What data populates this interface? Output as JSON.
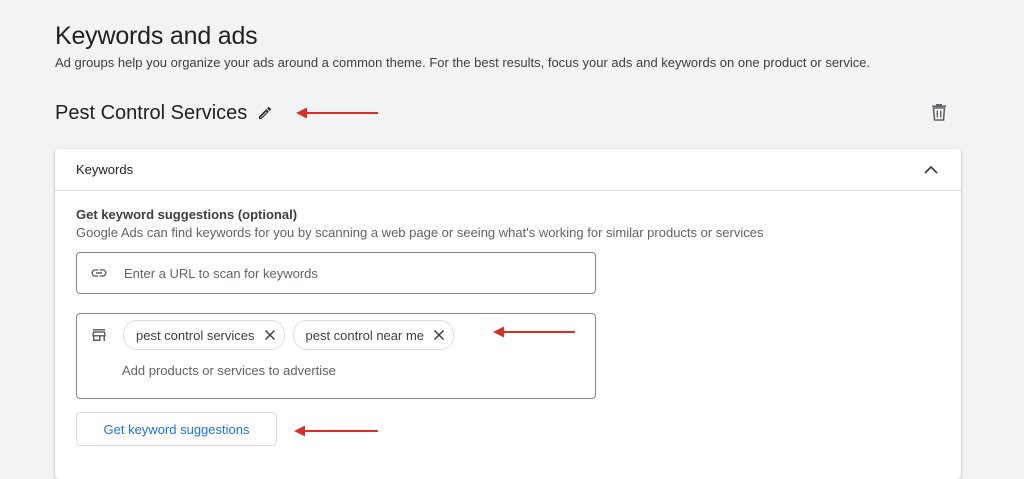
{
  "header": {
    "title": "Keywords and ads",
    "subtitle": "Ad groups help you organize your ads around a common theme. For the best results, focus your ads and keywords on one product or service."
  },
  "ad_group": {
    "name": "Pest Control Services",
    "edit_icon": "pencil-icon",
    "delete_icon": "trash-icon"
  },
  "keywords_card": {
    "header_title": "Keywords",
    "collapse_icon": "chevron-up-icon",
    "suggestions_title": "Get keyword suggestions (optional)",
    "suggestions_desc": "Google Ads can find keywords for you by scanning a web page or seeing what's working for similar products or services",
    "url_field": {
      "icon": "link-icon",
      "placeholder": "Enter a URL to scan for keywords",
      "value": ""
    },
    "products_field": {
      "icon": "storefront-icon",
      "chips": [
        {
          "label": "pest control services"
        },
        {
          "label": "pest control near me"
        }
      ],
      "placeholder": "Add products or services to advertise"
    },
    "suggest_button": "Get keyword suggestions"
  },
  "annotation_color": "#d93025",
  "colors": {
    "accent": "#1a73e8",
    "background": "#f1f3f4",
    "arrow": "#d93025"
  }
}
